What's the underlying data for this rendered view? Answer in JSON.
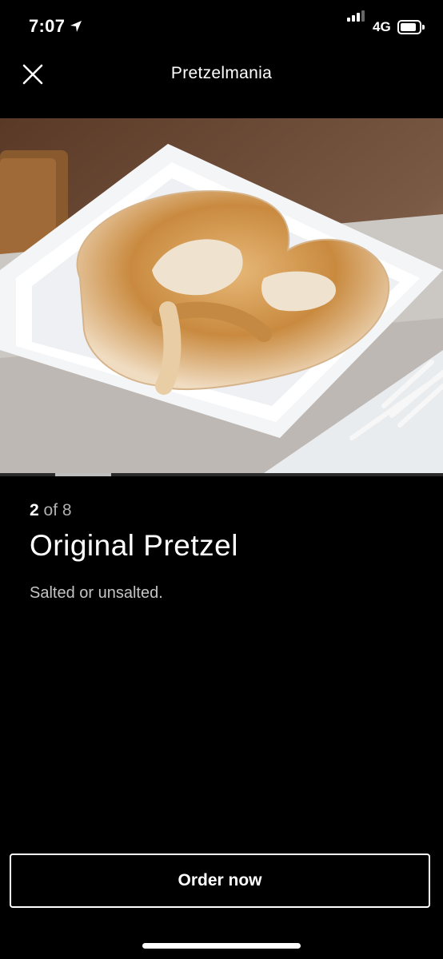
{
  "status_bar": {
    "time": "7:07",
    "network": "4G",
    "icons": [
      "location-arrow-icon",
      "signal-icon",
      "battery-icon"
    ]
  },
  "header": {
    "title": "Pretzelmania",
    "close_icon": "close-icon"
  },
  "item": {
    "image_alt": "pretzel on white plate",
    "index_current": "2",
    "index_sep": " of ",
    "index_total": "8",
    "name": "Original Pretzel",
    "description": "Salted or unsalted."
  },
  "gallery": {
    "current": 2,
    "total": 8
  },
  "actions": {
    "order_label": "Order now"
  },
  "colors": {
    "background": "#000000",
    "text": "#ffffff",
    "muted": "#c4c4c4"
  }
}
